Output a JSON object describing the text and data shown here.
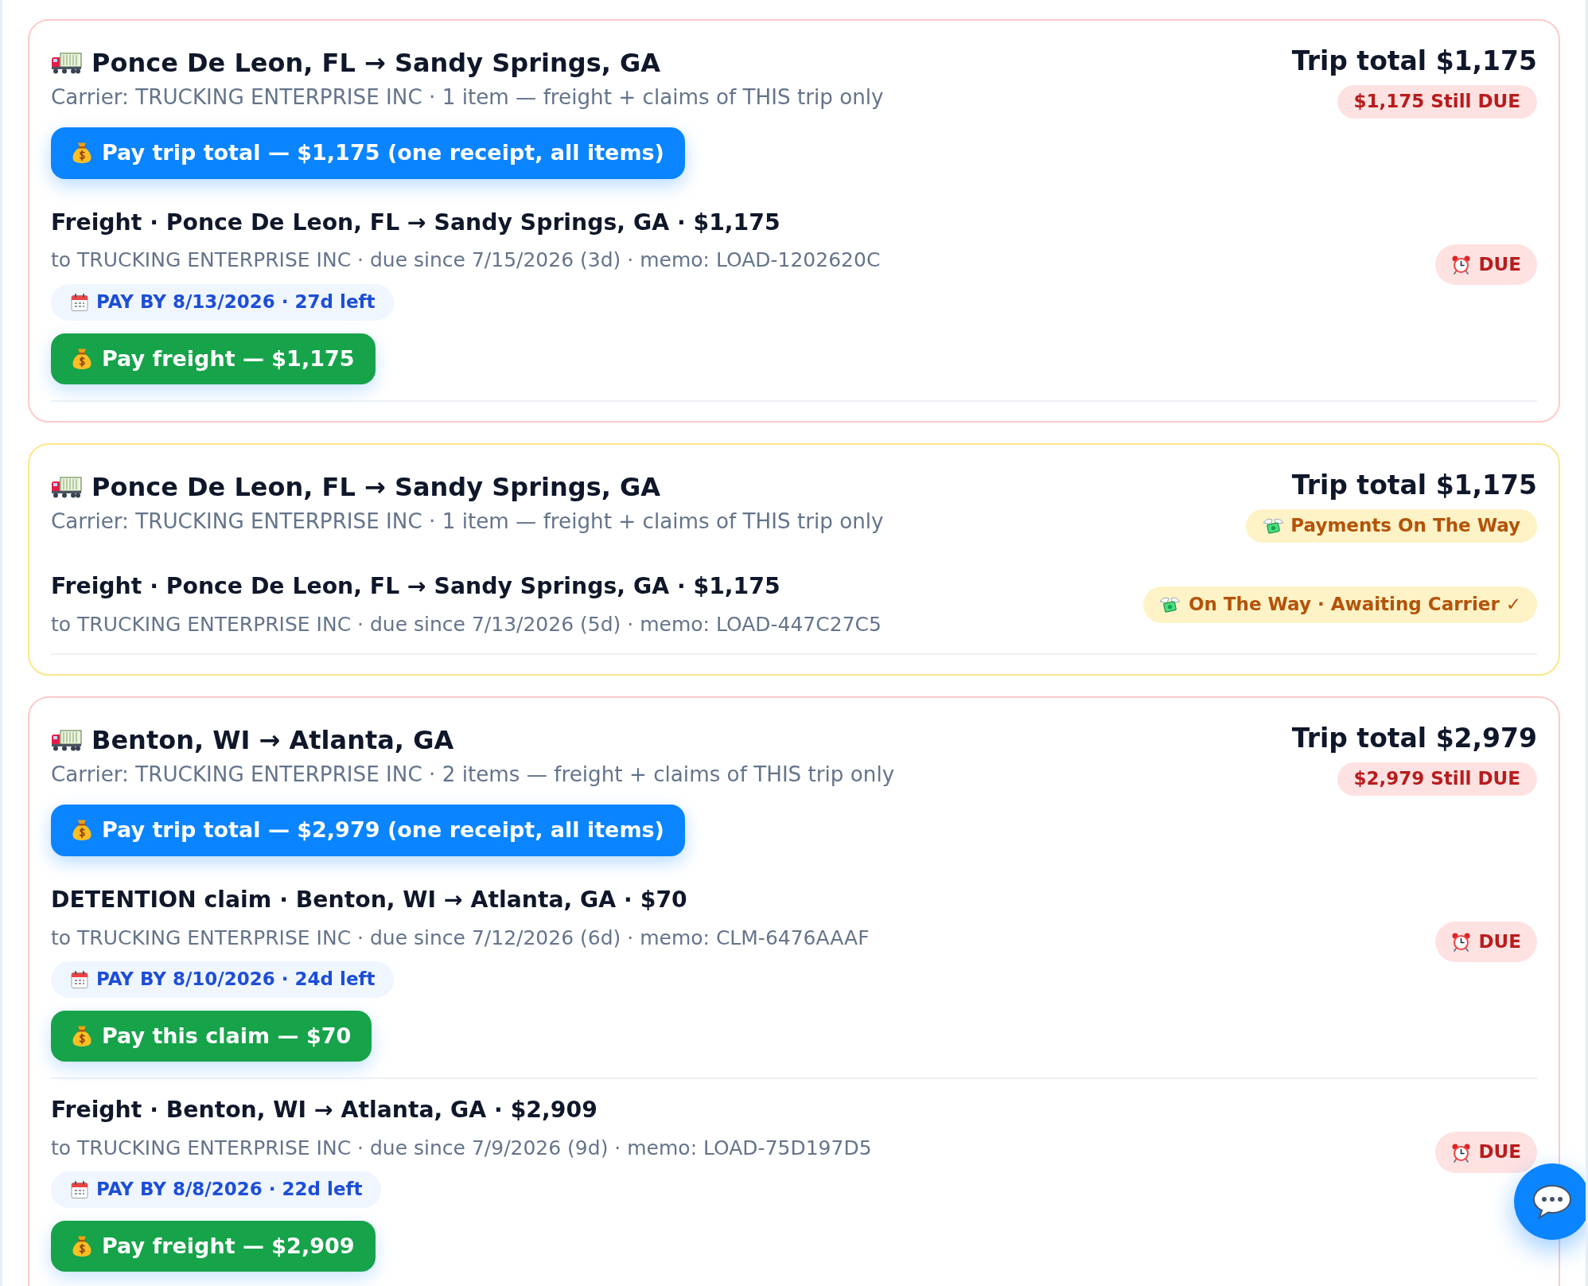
{
  "trips": [
    {
      "kind": "due",
      "title": "Ponce De Leon, FL → Sandy Springs, GA",
      "subtitle": "Carrier: TRUCKING ENTERPRISE INC · 1 item — freight + claims of THIS trip only",
      "trip_total": "Trip total $1,175",
      "balance_badge": "$1,175 Still DUE",
      "pay_total_button": "Pay trip total — $1,175 (one receipt, all items)",
      "items": [
        {
          "kind": "due",
          "title": "Freight · Ponce De Leon, FL → Sandy Springs, GA · $1,175",
          "details": "to TRUCKING ENTERPRISE INC · due since 7/15/2026 (3d) · memo: LOAD-1202620C",
          "pay_by": "PAY BY 8/13/2026 · 27d left",
          "status_label": "DUE",
          "pay_button": "Pay freight — $1,175"
        }
      ]
    },
    {
      "kind": "transit",
      "title": "Ponce De Leon, FL → Sandy Springs, GA",
      "subtitle": "Carrier: TRUCKING ENTERPRISE INC · 1 item — freight + claims of THIS trip only",
      "trip_total": "Trip total $1,175",
      "balance_badge": "Payments On The Way",
      "items": [
        {
          "kind": "transit",
          "title": "Freight · Ponce De Leon, FL → Sandy Springs, GA · $1,175",
          "details": "to TRUCKING ENTERPRISE INC · due since 7/13/2026 (5d) · memo: LOAD-447C27C5",
          "status_label": "On The Way · Awaiting Carrier ✓"
        }
      ]
    },
    {
      "kind": "due",
      "title": "Benton, WI → Atlanta, GA",
      "subtitle": "Carrier: TRUCKING ENTERPRISE INC · 2 items — freight + claims of THIS trip only",
      "trip_total": "Trip total $2,979",
      "balance_badge": "$2,979 Still DUE",
      "pay_total_button": "Pay trip total — $2,979 (one receipt, all items)",
      "items": [
        {
          "kind": "due",
          "title": "DETENTION claim · Benton, WI → Atlanta, GA · $70",
          "details": "to TRUCKING ENTERPRISE INC · due since 7/12/2026 (6d) · memo: CLM-6476AAAF",
          "pay_by": "PAY BY 8/10/2026 · 24d left",
          "status_label": "DUE",
          "pay_button": "Pay this claim — $70"
        },
        {
          "kind": "due",
          "title": "Freight · Benton, WI → Atlanta, GA · $2,909",
          "details": "to TRUCKING ENTERPRISE INC · due since 7/9/2026 (9d) · memo: LOAD-75D197D5",
          "pay_by": "PAY BY 8/8/2026 · 22d left",
          "status_label": "DUE",
          "pay_button": "Pay freight — $2,909"
        }
      ]
    }
  ]
}
